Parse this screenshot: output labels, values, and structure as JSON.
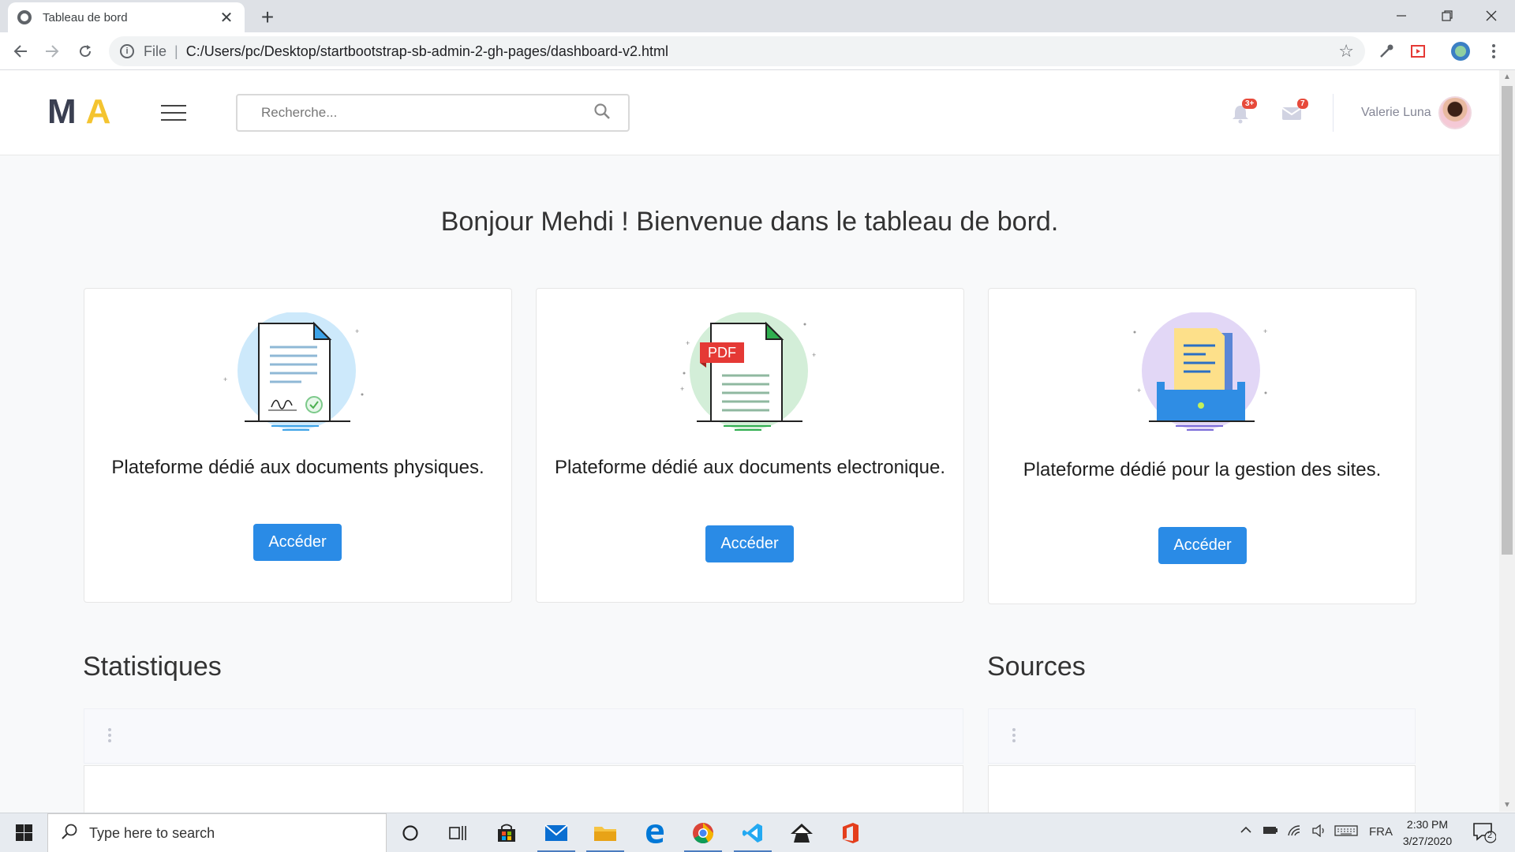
{
  "browser": {
    "tab_title": "Tableau de bord",
    "tab_close": "✕",
    "new_tab": "+",
    "scheme": "File",
    "separator": "|",
    "url": "C:/Users/pc/Desktop/startbootstrap-sb-admin-2-gh-pages/dashboard-v2.html"
  },
  "header": {
    "logo_m": "M",
    "logo_a": "A",
    "search_placeholder": "Recherche...",
    "alerts_badge": "3+",
    "messages_badge": "7",
    "user_name": "Valerie Luna"
  },
  "welcome": "Bonjour Mehdi ! Bienvenue dans le tableau de bord.",
  "cards": [
    {
      "text": "Plateforme dédié aux documents physiques.",
      "button": "Accéder",
      "icon": "signed-document-icon"
    },
    {
      "text": "Plateforme dédié aux documents electronique.",
      "button": "Accéder",
      "icon": "pdf-document-icon",
      "pdf_label": "PDF"
    },
    {
      "text": "Plateforme dédié pour la gestion des sites.",
      "button": "Accéder",
      "icon": "folder-archive-icon"
    }
  ],
  "sections": {
    "stats": "Statistiques",
    "sources": "Sources"
  },
  "taskbar": {
    "search_label": "Type here to search",
    "language": "FRA",
    "time": "2:30 PM",
    "date": "3/27/2020",
    "notifications": "2"
  },
  "colors": {
    "primary_button": "#2a8be6",
    "logo_dark": "#3a3f51",
    "logo_accent": "#f4c430",
    "badge": "#e74a3b"
  }
}
